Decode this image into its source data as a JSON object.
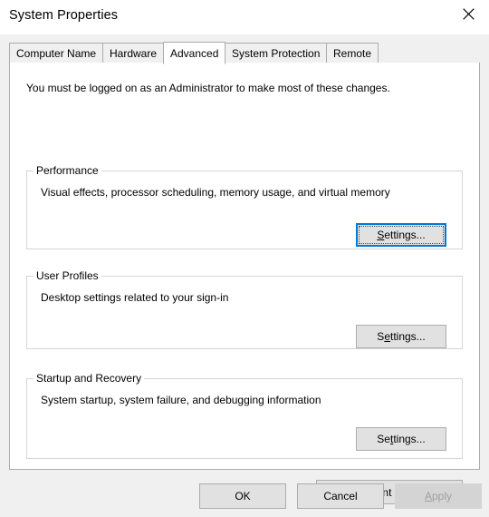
{
  "window": {
    "title": "System Properties",
    "close_icon": "close-icon"
  },
  "tabs": [
    {
      "label": "Computer Name",
      "selected": false
    },
    {
      "label": "Hardware",
      "selected": false
    },
    {
      "label": "Advanced",
      "selected": true
    },
    {
      "label": "System Protection",
      "selected": false
    },
    {
      "label": "Remote",
      "selected": false
    }
  ],
  "panel": {
    "admin_notice": "You must be logged on as an Administrator to make most of these changes.",
    "groups": [
      {
        "label": "Performance",
        "description": "Visual effects, processor scheduling, memory usage, and virtual memory",
        "button": {
          "label": "Settings...",
          "accesskey": "S",
          "prefix": "",
          "suffix": "ettings...",
          "focused": true,
          "disabled": false
        }
      },
      {
        "label": "User Profiles",
        "description": "Desktop settings related to your sign-in",
        "button": {
          "label": "Settings...",
          "accesskey": "e",
          "prefix": "S",
          "suffix": "ttings...",
          "focused": false,
          "disabled": false
        }
      },
      {
        "label": "Startup and Recovery",
        "description": "System startup, system failure, and debugging information",
        "button": {
          "label": "Settings...",
          "accesskey": "t",
          "prefix": "Se",
          "suffix": "tings...",
          "focused": false,
          "disabled": false
        }
      }
    ],
    "environment_variables_button": {
      "label": "Environment Variables...",
      "accesskey": "n",
      "prefix": "Enviro",
      "suffix": "ment Variables..."
    }
  },
  "footer": {
    "ok": {
      "label": "OK",
      "disabled": false
    },
    "cancel": {
      "label": "Cancel",
      "disabled": false
    },
    "apply": {
      "label": "Apply",
      "accesskey": "A",
      "prefix": "",
      "suffix": "pply",
      "disabled": true
    }
  },
  "colors": {
    "accent": "#0078d7",
    "dialog_background": "#f0f0f0",
    "panel_background": "#ffffff",
    "button_face": "#e1e1e1",
    "button_border": "#adadad",
    "disabled_text": "#a0a0a0",
    "group_border": "#d5d5d5",
    "tab_border": "#acacac"
  }
}
